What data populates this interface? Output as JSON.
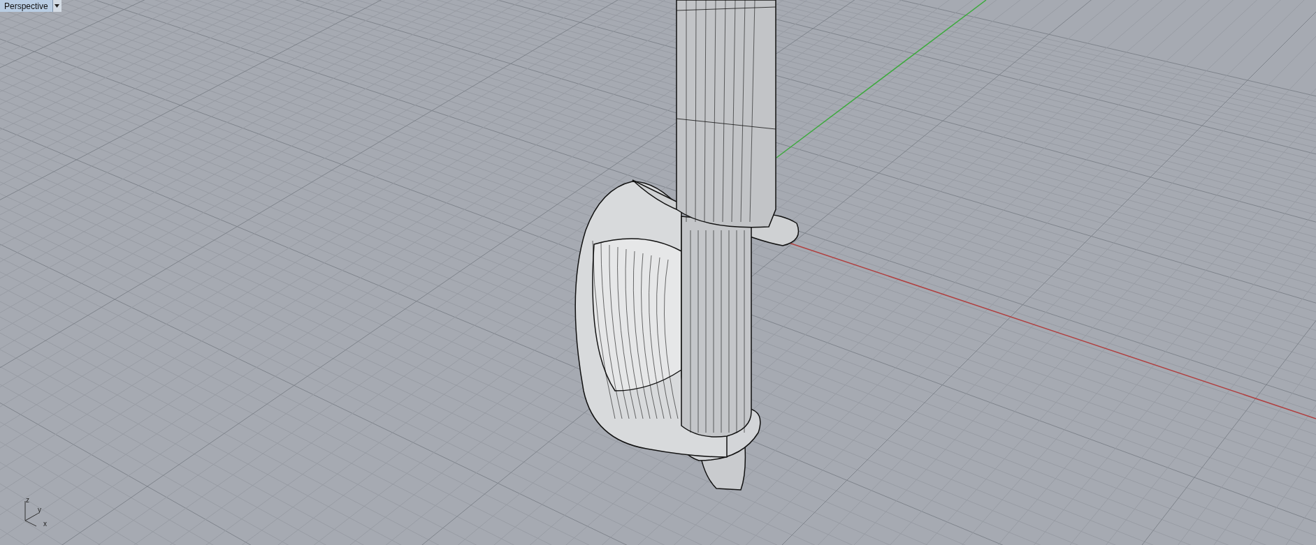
{
  "viewport": {
    "title": "Perspective"
  },
  "axis_labels": [
    "z",
    "y",
    "x"
  ]
}
